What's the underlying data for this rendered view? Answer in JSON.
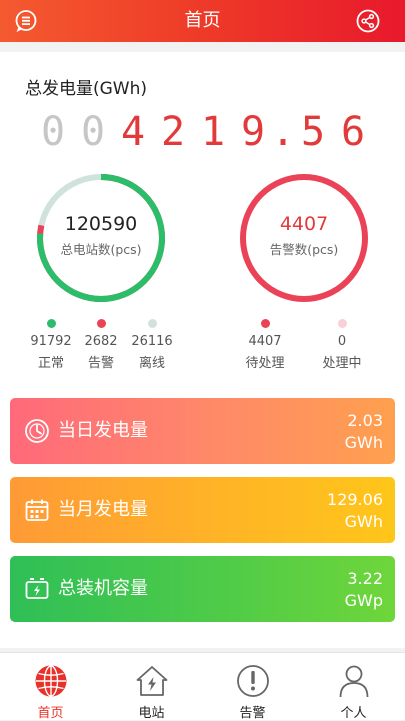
{
  "header": {
    "title": "首页",
    "left_icon": "message-menu-icon",
    "right_icon": "share-icon"
  },
  "generation": {
    "label": "总发电量(GWh)",
    "digits": [
      "0",
      "0",
      "4",
      "2",
      "1",
      "9",
      ".",
      "5",
      "6"
    ]
  },
  "stations": {
    "total": "120590",
    "total_label": "总电站数(pcs)",
    "ring_fraction_normal": 0.761,
    "ring_fraction_alarm": 0.022,
    "ring_fraction_offline": 0.217,
    "stats": [
      {
        "value": "91792",
        "label": "正常",
        "color": "#2bbd6a"
      },
      {
        "value": "2682",
        "label": "告警",
        "color": "#ea4357"
      },
      {
        "value": "26116",
        "label": "离线",
        "color": "#cfe3dc"
      }
    ]
  },
  "alarms": {
    "total": "4407",
    "total_label": "告警数(pcs)",
    "stats": [
      {
        "value": "4407",
        "label": "待处理",
        "color": "#ea4357"
      },
      {
        "value": "0",
        "label": "处理中",
        "color": "#f8d0d8"
      }
    ]
  },
  "cards": [
    {
      "label": "当日发电量",
      "value": "2.03",
      "unit": "GWh",
      "icon": "clock-icon"
    },
    {
      "label": "当月发电量",
      "value": "129.06",
      "unit": "GWh",
      "icon": "calendar-icon"
    },
    {
      "label": "总装机容量",
      "value": "3.22",
      "unit": "GWp",
      "icon": "battery-icon"
    }
  ],
  "tabs": [
    {
      "label": "首页",
      "icon": "globe-icon",
      "active": true
    },
    {
      "label": "电站",
      "icon": "house-bolt-icon",
      "active": false
    },
    {
      "label": "告警",
      "icon": "alert-icon",
      "active": false
    },
    {
      "label": "个人",
      "icon": "person-icon",
      "active": false
    }
  ],
  "colors": {
    "accent": "#e8312a",
    "normal": "#2bbd6a",
    "alarm": "#ea4357",
    "offline": "#cfe3dc"
  }
}
